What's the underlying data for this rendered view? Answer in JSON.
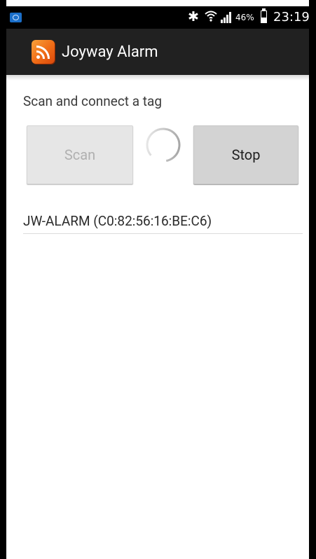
{
  "status_bar": {
    "app_icon": "notification-app-icon",
    "bluetooth_icon": "bluetooth-icon",
    "wifi_icon": "wifi-icon",
    "signal_icon": "cell-signal-icon",
    "battery_percent": "46%",
    "battery_level": 0.46,
    "time": "23:19"
  },
  "action_bar": {
    "logo_icon": "rss-feed-icon",
    "title": "Joyway Alarm",
    "background_color": "#212121",
    "logo_color": "#ef6b16"
  },
  "main": {
    "section_label": "Scan and connect a tag",
    "scan_button": {
      "label": "Scan",
      "enabled": false
    },
    "progress_spinner": "loading-spinner",
    "stop_button": {
      "label": "Stop",
      "enabled": true
    },
    "devices": [
      {
        "label": "JW-ALARM (C0:82:56:16:BE:C6)"
      }
    ]
  }
}
